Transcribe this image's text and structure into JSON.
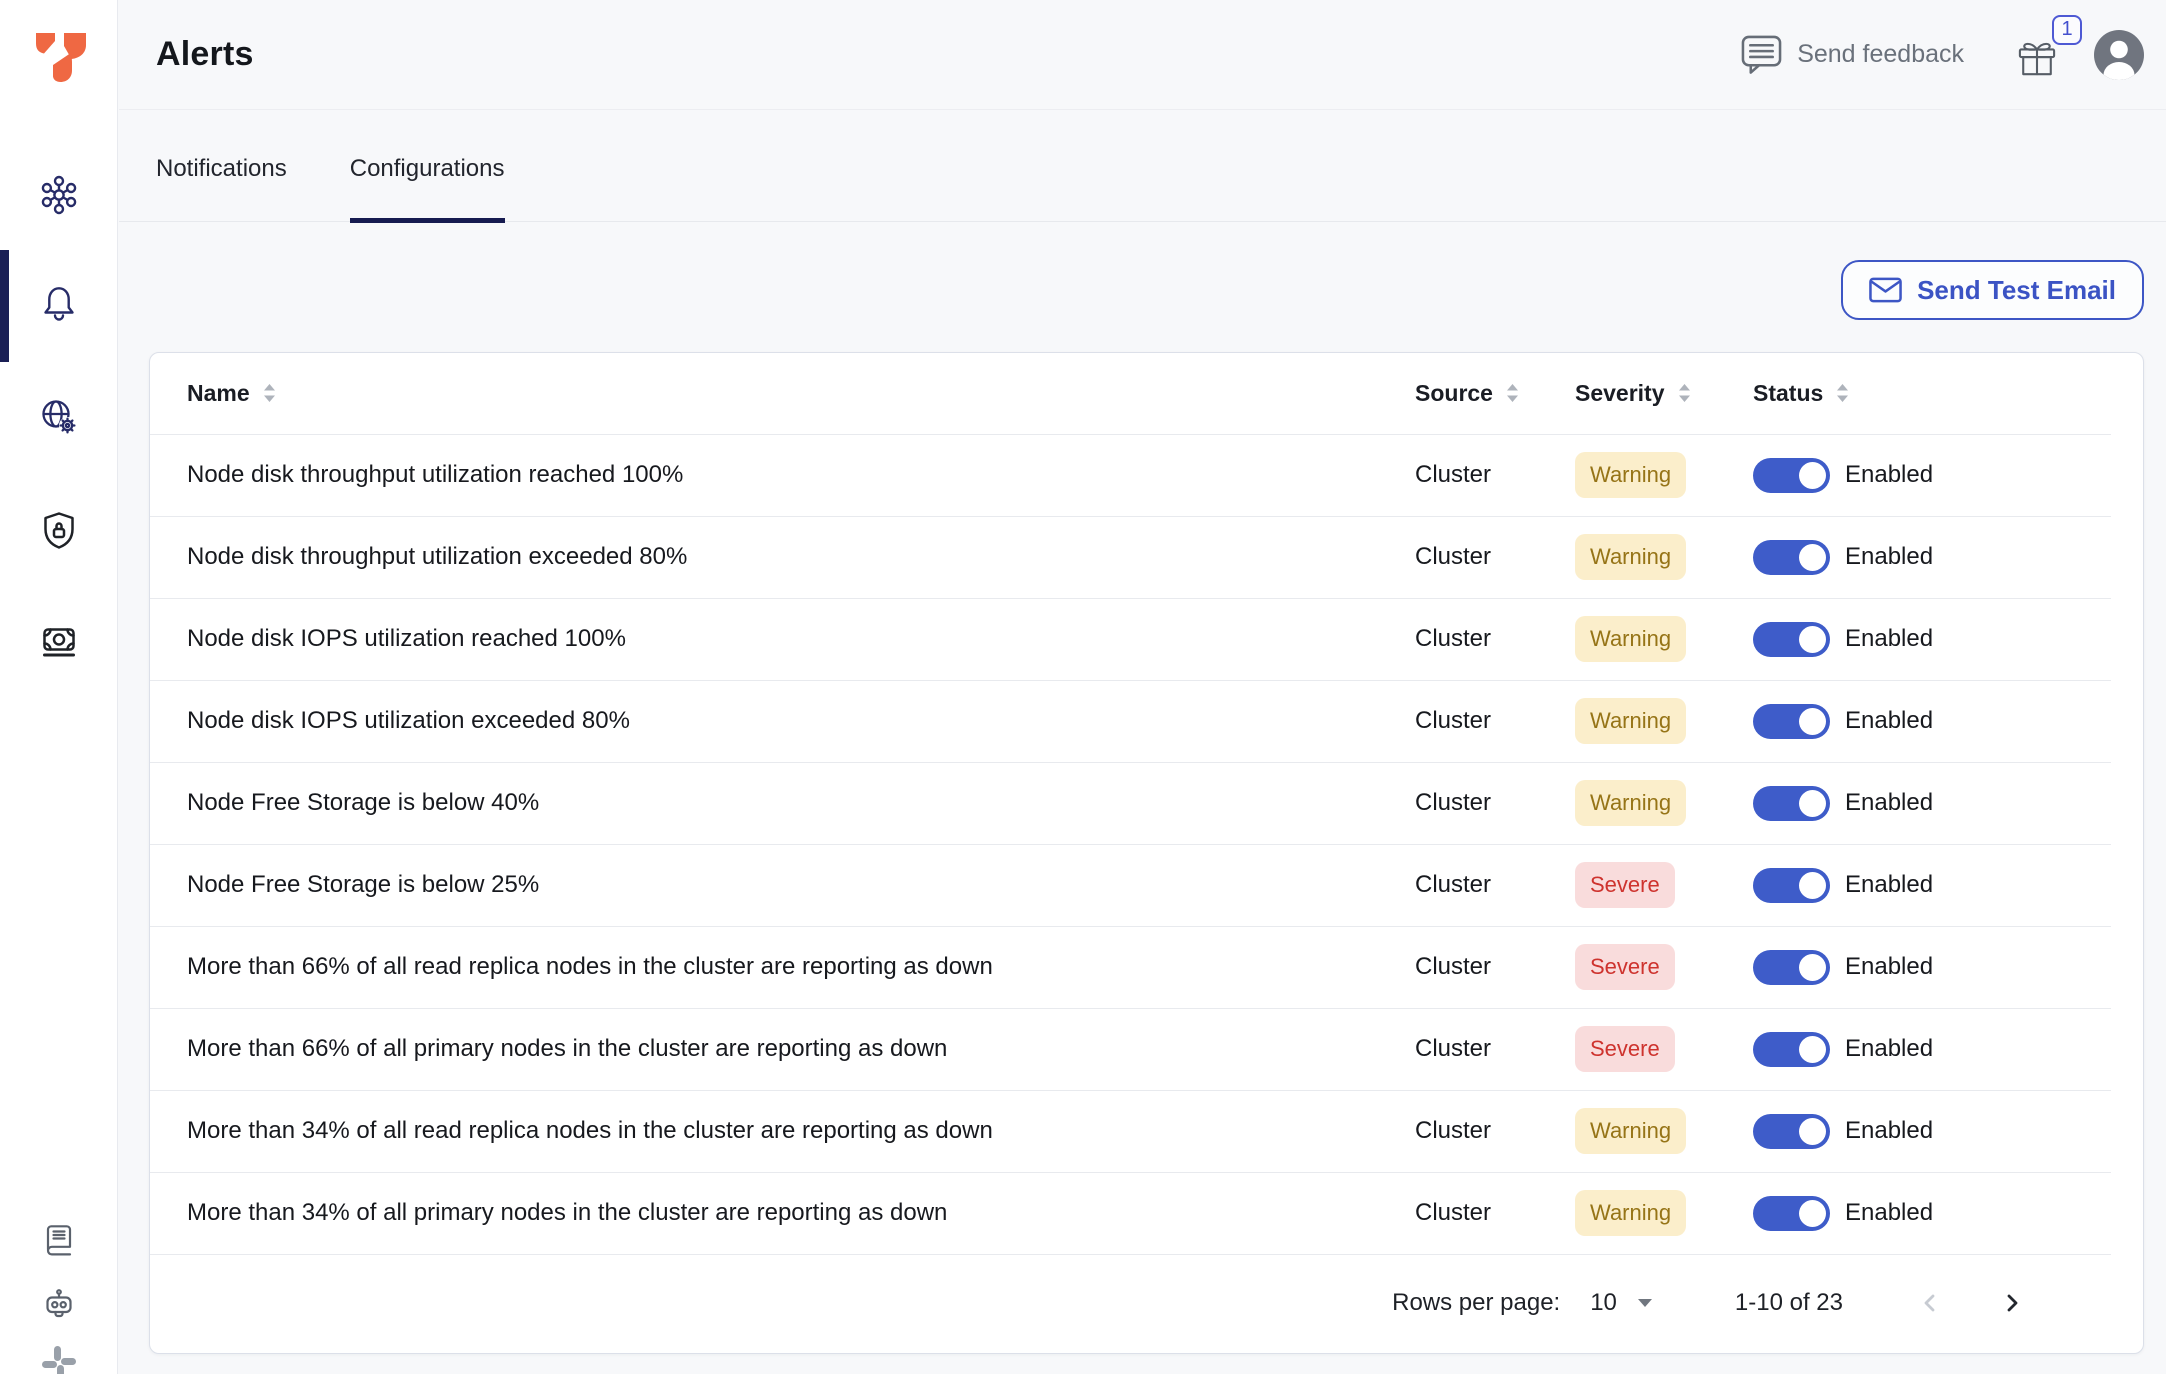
{
  "page_title": "Alerts",
  "topbar": {
    "send_feedback_label": "Send feedback",
    "gift_badge_count": "1",
    "icons": [
      "feedback-bubble-icon",
      "gift-icon",
      "avatar"
    ]
  },
  "sidebar": {
    "icons": [
      "yugabyte-logo",
      "clusters-icon",
      "alerts-bell-icon",
      "network-globe-gear-icon",
      "security-shield-icon",
      "billing-money-icon",
      "docs-icon",
      "assistant-robot-icon",
      "slack-icon"
    ],
    "active_item": "alerts"
  },
  "tabs": [
    {
      "label": "Notifications",
      "active": false
    },
    {
      "label": "Configurations",
      "active": true
    }
  ],
  "toolbar": {
    "send_test_email_label": "Send Test Email"
  },
  "table": {
    "columns": [
      "Name",
      "Source",
      "Severity",
      "Status"
    ],
    "rows": [
      {
        "name": "Node disk throughput utilization reached 100%",
        "source": "Cluster",
        "severity": "Warning",
        "status": "Enabled",
        "enabled": true
      },
      {
        "name": "Node disk throughput utilization exceeded 80%",
        "source": "Cluster",
        "severity": "Warning",
        "status": "Enabled",
        "enabled": true
      },
      {
        "name": "Node disk IOPS utilization reached 100%",
        "source": "Cluster",
        "severity": "Warning",
        "status": "Enabled",
        "enabled": true
      },
      {
        "name": "Node disk IOPS utilization exceeded 80%",
        "source": "Cluster",
        "severity": "Warning",
        "status": "Enabled",
        "enabled": true
      },
      {
        "name": "Node Free Storage is below 40%",
        "source": "Cluster",
        "severity": "Warning",
        "status": "Enabled",
        "enabled": true
      },
      {
        "name": "Node Free Storage is below 25%",
        "source": "Cluster",
        "severity": "Severe",
        "status": "Enabled",
        "enabled": true
      },
      {
        "name": "More than 66% of all read replica nodes in the cluster are reporting as down",
        "source": "Cluster",
        "severity": "Severe",
        "status": "Enabled",
        "enabled": true
      },
      {
        "name": "More than 66% of all primary nodes in the cluster are reporting as down",
        "source": "Cluster",
        "severity": "Severe",
        "status": "Enabled",
        "enabled": true
      },
      {
        "name": "More than 34% of all read replica nodes in the cluster are reporting as down",
        "source": "Cluster",
        "severity": "Warning",
        "status": "Enabled",
        "enabled": true
      },
      {
        "name": "More than 34% of all primary nodes in the cluster are reporting as down",
        "source": "Cluster",
        "severity": "Warning",
        "status": "Enabled",
        "enabled": true
      }
    ]
  },
  "pagination": {
    "rows_per_page_label": "Rows per page:",
    "rows_per_page_value": "10",
    "range_label": "1-10 of 23"
  },
  "colors": {
    "brand_orange": "#EF6843",
    "accent_blue": "#3E5CC9",
    "nav_navy": "#272C68",
    "tab_underline": "#161B50",
    "warning_bg": "#FBEECB",
    "warning_text": "#967417",
    "severe_bg": "#F9DCDC",
    "severe_text": "#CE332E",
    "page_bg": "#F7F8FA"
  }
}
